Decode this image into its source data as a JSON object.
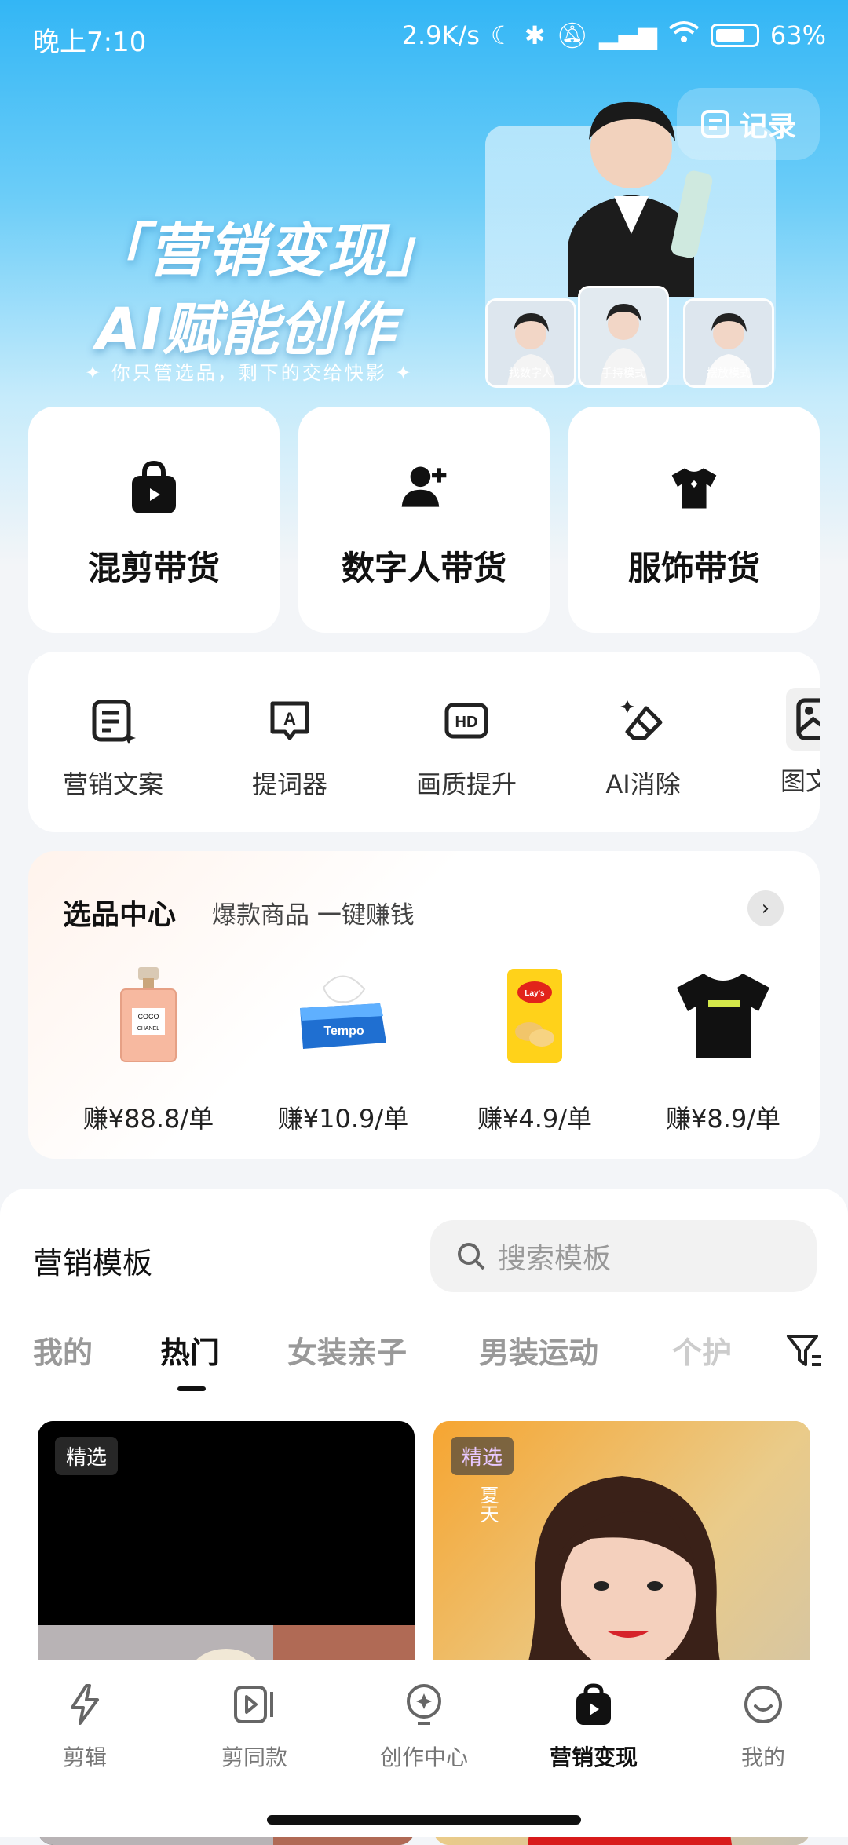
{
  "status_bar": {
    "time": "晚上7:10",
    "speed": "2.9K/s",
    "battery": "63%"
  },
  "header": {
    "record_label": "记录"
  },
  "hero": {
    "title_line1": "「营销变现」",
    "title_line2": "AI赋能创作",
    "subtitle": "✦ 你只管选品，剩下的交给快影 ✦",
    "thumb_labels": [
      "找数字人",
      "手持模式",
      "摆放模式"
    ]
  },
  "main_cards": [
    {
      "label": "混剪带货",
      "icon": "shopping-bag-icon"
    },
    {
      "label": "数字人带货",
      "icon": "add-person-icon"
    },
    {
      "label": "服饰带货",
      "icon": "tshirt-icon"
    }
  ],
  "tools": [
    {
      "label": "营销文案",
      "icon": "copywriting-icon"
    },
    {
      "label": "提词器",
      "icon": "teleprompter-icon"
    },
    {
      "label": "画质提升",
      "icon": "hd-icon"
    },
    {
      "label": "AI消除",
      "icon": "ai-eraser-icon"
    },
    {
      "label": "图文营",
      "icon": "image-text-icon"
    }
  ],
  "selection": {
    "title": "选品中心",
    "subtitle": "爆款商品 一键赚钱",
    "products": [
      {
        "name": "perfume",
        "price": "赚¥88.8/单"
      },
      {
        "name": "tissue",
        "price": "赚¥10.9/单"
      },
      {
        "name": "chips",
        "price": "赚¥4.9/单"
      },
      {
        "name": "tshirt",
        "price": "赚¥8.9/单"
      }
    ]
  },
  "templates": {
    "title": "营销模板",
    "search_placeholder": "搜索模板",
    "tabs": [
      "我的",
      "热门",
      "女装亲子",
      "男装运动",
      "个护"
    ],
    "active_tab": "热门",
    "cards": [
      {
        "tag": "精选"
      },
      {
        "tag": "精选",
        "overlay_text": "夏天"
      }
    ]
  },
  "bottom_nav": [
    {
      "label": "剪辑",
      "icon": "lightning-icon"
    },
    {
      "label": "剪同款",
      "icon": "video-play-icon"
    },
    {
      "label": "创作中心",
      "icon": "sparkle-icon"
    },
    {
      "label": "营销变现",
      "icon": "shopping-bag-play-icon",
      "active": true
    },
    {
      "label": "我的",
      "icon": "smile-face-icon"
    }
  ]
}
